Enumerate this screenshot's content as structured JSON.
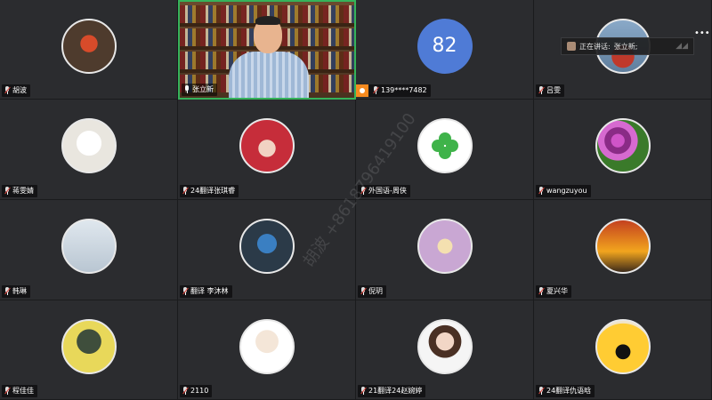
{
  "speaking_toast": {
    "label": "正在讲话:",
    "speaker": "张立新;"
  },
  "watermark": "胡波 +8618796419100",
  "participants": [
    {
      "name": "胡波",
      "avatar": "avatar-photo"
    },
    {
      "name": "张立新",
      "avatar": "video",
      "speaking": true
    },
    {
      "name": "139****7482",
      "avatar": "number-avatar",
      "avatar_text": "82",
      "host": true
    },
    {
      "name": "吕雯",
      "avatar": "avatar-photo"
    },
    {
      "name": "蒋雯婧",
      "avatar": "avatar-photo"
    },
    {
      "name": "24翻译张琪睿",
      "avatar": "avatar-photo"
    },
    {
      "name": "外国语-周侠",
      "avatar": "clover-avatar"
    },
    {
      "name": "wangzuyou",
      "avatar": "avatar-photo"
    },
    {
      "name": "韩琳",
      "avatar": "avatar-photo"
    },
    {
      "name": "翻译 李沐林",
      "avatar": "avatar-photo"
    },
    {
      "name": "倪玥",
      "avatar": "avatar-photo"
    },
    {
      "name": "夏兴华",
      "avatar": "avatar-photo"
    },
    {
      "name": "程佳佳",
      "avatar": "avatar-photo"
    },
    {
      "name": "2110",
      "avatar": "avatar-photo"
    },
    {
      "name": "21翻译24赵婉婷",
      "avatar": "avatar-photo"
    },
    {
      "name": "24翻译仇语晗",
      "avatar": "avatar-photo"
    }
  ],
  "colors": {
    "active_border": "#35b35a",
    "number_avatar": "#4f7bd6",
    "host_badge": "#f58a1f"
  }
}
